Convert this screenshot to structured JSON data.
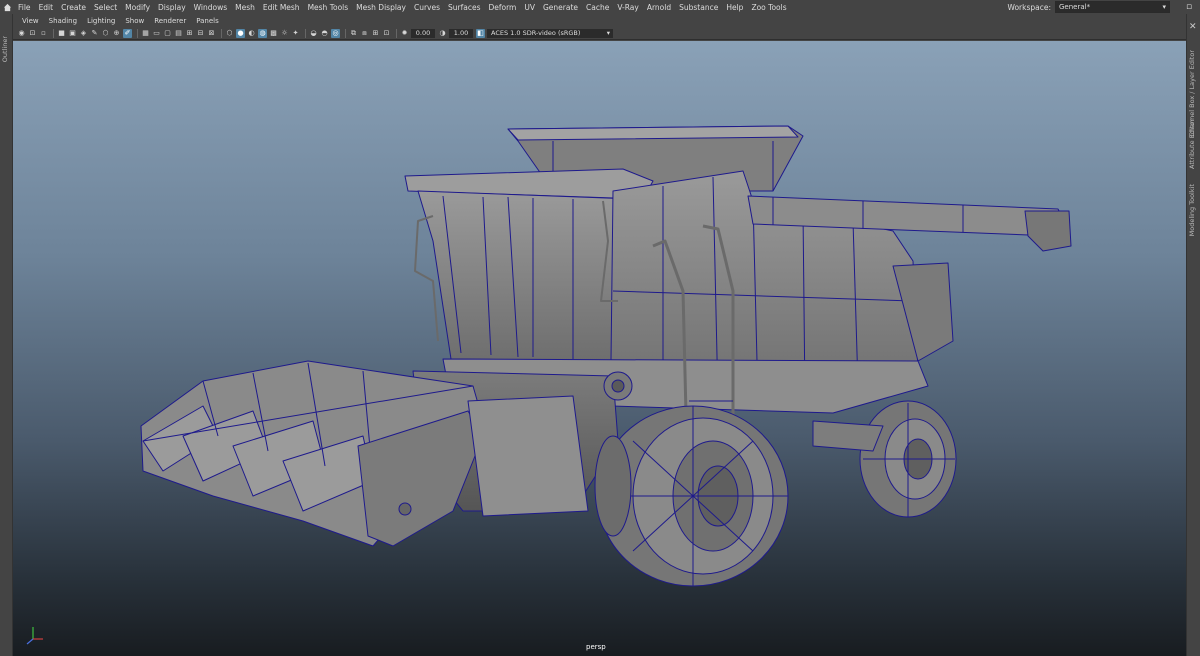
{
  "menubar": {
    "items": [
      "File",
      "Edit",
      "Create",
      "Select",
      "Modify",
      "Display",
      "Windows",
      "Mesh",
      "Edit Mesh",
      "Mesh Tools",
      "Mesh Display",
      "Curves",
      "Surfaces",
      "Deform",
      "UV",
      "Generate",
      "Cache",
      "V-Ray",
      "Arnold",
      "Substance",
      "Help",
      "Zoo Tools"
    ],
    "workspace_label": "Workspace:",
    "workspace_value": "General*"
  },
  "panel_menu": {
    "items": [
      "View",
      "Shading",
      "Lighting",
      "Show",
      "Renderer",
      "Panels"
    ]
  },
  "toolbar": {
    "exposure": "0.00",
    "gamma": "1.00",
    "color_space": "ACES 1.0 SDR-video (sRGB)"
  },
  "side_tabs": {
    "left": "Outliner",
    "right": [
      "Channel Box / Layer Editor",
      "Attribute Editor",
      "Modeling Toolkit"
    ]
  },
  "viewport": {
    "camera": "persp"
  },
  "colors": {
    "accent": "#5285a6",
    "wireframe": "#1e1a8c",
    "model": "#8a8a8a"
  }
}
